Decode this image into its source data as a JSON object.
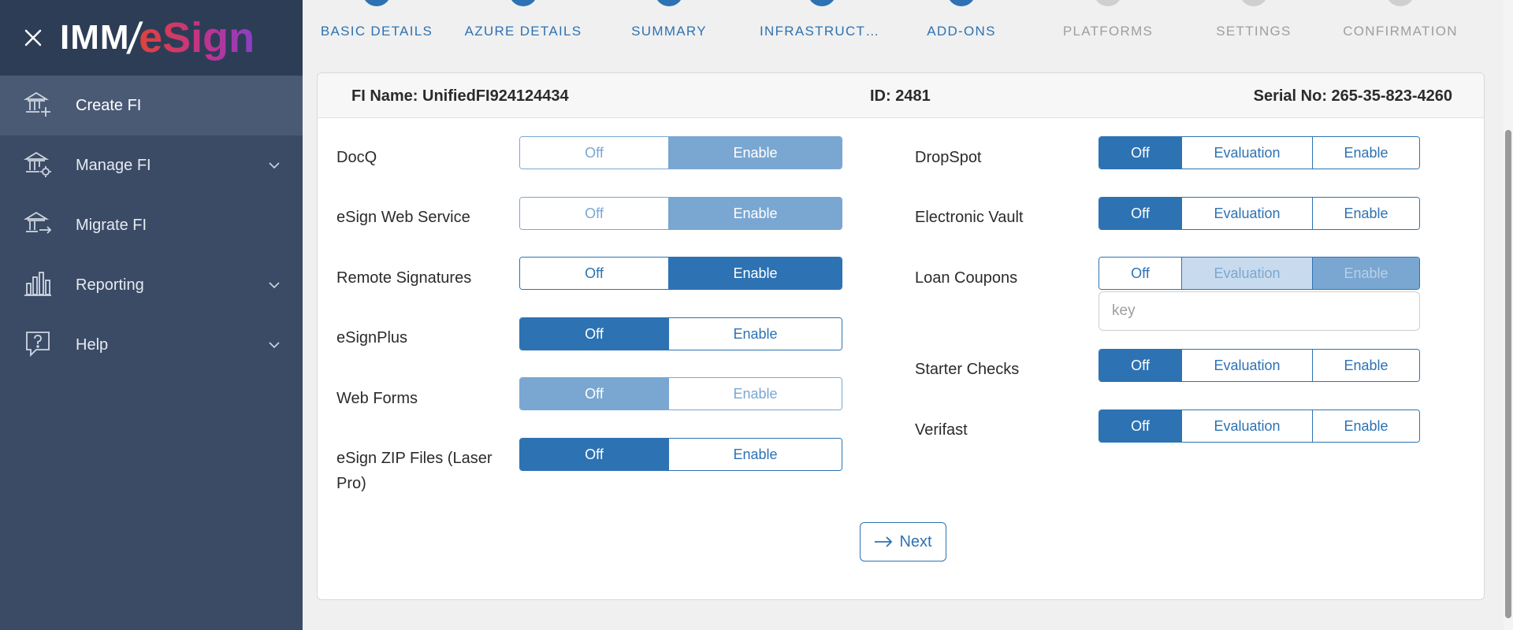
{
  "sidebar": {
    "logo": {
      "imm": "IMM",
      "slash": "/",
      "esign": "eSign"
    },
    "items": [
      {
        "label": "Create FI",
        "icon": "bank-add-icon",
        "active": true
      },
      {
        "label": "Manage FI",
        "icon": "bank-gear-icon",
        "has_chevron": true
      },
      {
        "label": "Migrate FI",
        "icon": "bank-arrow-icon"
      },
      {
        "label": "Reporting",
        "icon": "bar-chart-icon",
        "has_chevron": true
      },
      {
        "label": "Help",
        "icon": "help-bubble-icon",
        "has_chevron": true
      }
    ]
  },
  "steps": [
    {
      "label": "BASIC DETAILS",
      "status": "done"
    },
    {
      "label": "AZURE DETAILS",
      "status": "done"
    },
    {
      "label": "SUMMARY",
      "status": "done"
    },
    {
      "label": "INFRASTRUCTURE",
      "status": "done"
    },
    {
      "label": "ADD-ONS",
      "status": "current"
    },
    {
      "label": "PLATFORMS",
      "status": "todo"
    },
    {
      "label": "SETTINGS",
      "status": "todo"
    },
    {
      "label": "CONFIRMATION",
      "status": "todo"
    }
  ],
  "header": {
    "fi_name": "FI Name: UnifiedFI924124434",
    "id": "ID: 2481",
    "serial": "Serial No: 265-35-823-4260"
  },
  "left_addons": [
    {
      "label": "DocQ",
      "off": "Off",
      "enable": "Enable",
      "selected": "Enable",
      "disabled": true
    },
    {
      "label": "eSign Web Service",
      "off": "Off",
      "enable": "Enable",
      "selected": "Enable",
      "disabled": true
    },
    {
      "label": "Remote Signatures",
      "off": "Off",
      "enable": "Enable",
      "selected": "Enable",
      "disabled": false
    },
    {
      "label": "eSignPlus",
      "off": "Off",
      "enable": "Enable",
      "selected": "Off",
      "disabled": false
    },
    {
      "label": "Web Forms",
      "off": "Off",
      "enable": "Enable",
      "selected": "Off",
      "disabled": true
    },
    {
      "label": "eSign ZIP Files (Laser Pro)",
      "off": "Off",
      "enable": "Enable",
      "selected": "Off",
      "disabled": false
    }
  ],
  "right_addons": [
    {
      "label": "DropSpot",
      "off": "Off",
      "evaluation": "Evaluation",
      "enable": "Enable",
      "selected": "Off"
    },
    {
      "label": "Electronic Vault",
      "off": "Off",
      "evaluation": "Evaluation",
      "enable": "Enable",
      "selected": "Off"
    },
    {
      "label": "Loan Coupons",
      "off": "Off",
      "evaluation": "Evaluation",
      "enable": "Enable",
      "selected": "Off",
      "key_placeholder": "key"
    },
    {
      "label": "Starter Checks",
      "off": "Off",
      "evaluation": "Evaluation",
      "enable": "Enable",
      "selected": "Off"
    },
    {
      "label": "Verifast",
      "off": "Off",
      "evaluation": "Evaluation",
      "enable": "Enable",
      "selected": "Off"
    }
  ],
  "actions": {
    "next_label": "Next",
    "next_icon": "arrow-right-icon"
  },
  "colors": {
    "primary": "#2d72b3",
    "sidebar": "#3b4b66",
    "sidebar_header": "#2e3d56",
    "disabled": "#7aa7d1"
  }
}
